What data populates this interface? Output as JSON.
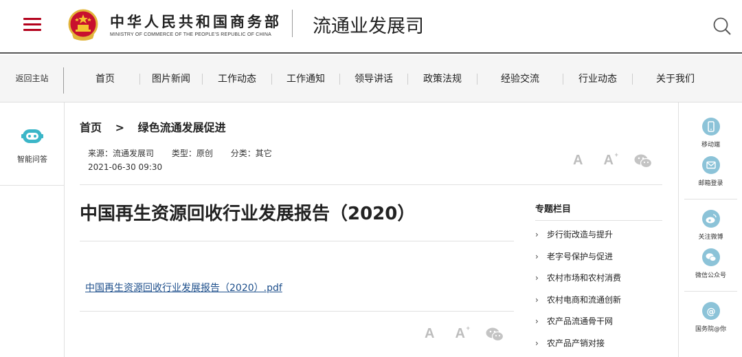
{
  "header": {
    "org_cn": "中华人民共和国商务部",
    "org_en": "MINISTRY OF COMMERCE OF THE PEOPLE'S REPUBLIC OF CHINA",
    "dept": "流通业发展司"
  },
  "nav": {
    "home": "返回主站",
    "items": [
      {
        "label": "首页"
      },
      {
        "label": "图片新闻"
      },
      {
        "label": "工作动态"
      },
      {
        "label": "工作通知"
      },
      {
        "label": "领导讲话"
      },
      {
        "label": "政策法规"
      },
      {
        "label": "经验交流"
      },
      {
        "label": "行业动态"
      },
      {
        "label": "关于我们"
      }
    ]
  },
  "left_rail": {
    "ai_label": "智能问答"
  },
  "breadcrumb": {
    "home": "首页",
    "sep": ">",
    "current": "绿色流通发展促进"
  },
  "meta": {
    "source": "来源：流通发展司",
    "type": "类型：原创",
    "category": "分类：其它",
    "date": "2021-06-30 09:30"
  },
  "tools": {
    "font_small": "A",
    "font_large": "A",
    "font_large_sup": "+"
  },
  "article": {
    "title": "中国再生资源回收行业发展报告（2020）",
    "attachment": "中国再生资源回收行业发展报告（2020）.pdf"
  },
  "special": {
    "heading": "专题栏目",
    "items": [
      {
        "label": "步行街改造与提升"
      },
      {
        "label": "老字号保护与促进"
      },
      {
        "label": "农村市场和农村消费"
      },
      {
        "label": "农村电商和流通创新"
      },
      {
        "label": "农产品流通骨干网"
      },
      {
        "label": "农产品产销对接"
      }
    ]
  },
  "right_rail": {
    "mobile": "移动端",
    "mail": "邮箱登录",
    "weibo": "关注微博",
    "wechat": "微信公众号",
    "council": "国务院@你"
  },
  "colors": {
    "brand_red": "#b3001b",
    "link_blue": "#1c4e8b",
    "rail_icon": "#8cc3d8",
    "ai_icon": "#3bb6c8"
  }
}
